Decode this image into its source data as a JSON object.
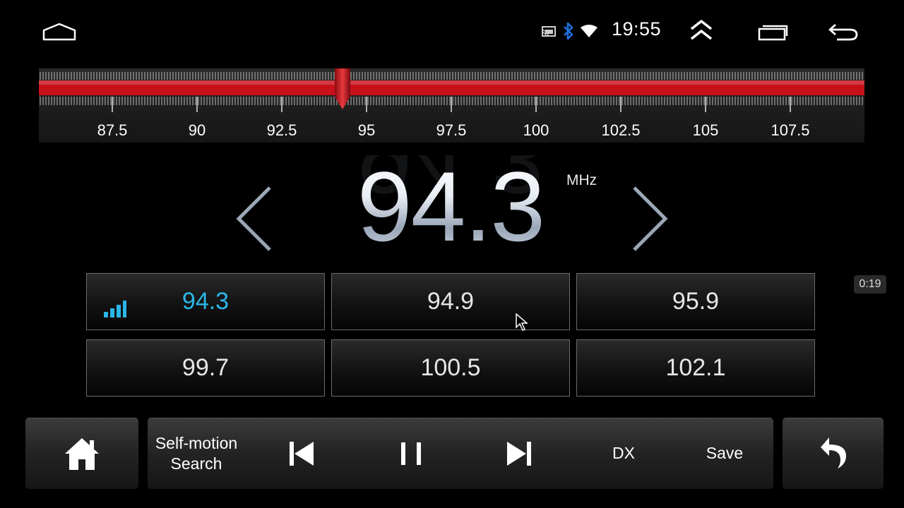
{
  "status_bar": {
    "time": "19:55",
    "icons": [
      "home-outline-icon",
      "cast-icon",
      "bluetooth-icon",
      "wifi-icon",
      "expand-up-icon",
      "recent-apps-icon",
      "back-arrow-icon"
    ],
    "bluetooth_color": "#1e6fe0"
  },
  "dial": {
    "min": 87.5,
    "max": 108.0,
    "labels": [
      "87.5",
      "90",
      "92.5",
      "95",
      "97.5",
      "100",
      "102.5",
      "105",
      "107.5"
    ],
    "current": 94.3,
    "band_color": "#c8101a"
  },
  "display": {
    "frequency": "94.3",
    "unit": "MHz"
  },
  "presets": [
    {
      "label": "94.3",
      "active": true
    },
    {
      "label": "94.9",
      "active": false
    },
    {
      "label": "95.9",
      "active": false
    },
    {
      "label": "99.7",
      "active": false
    },
    {
      "label": "100.5",
      "active": false
    },
    {
      "label": "102.1",
      "active": false
    }
  ],
  "accent_color": "#2bb6e8",
  "timer": "0:19",
  "controls": {
    "home": "home-icon",
    "search_line1": "Self-motion",
    "search_line2": "Search",
    "prev": "skip-previous-icon",
    "pause": "pause-icon",
    "next": "skip-next-icon",
    "dx": "DX",
    "save": "Save",
    "back": "return-icon"
  }
}
